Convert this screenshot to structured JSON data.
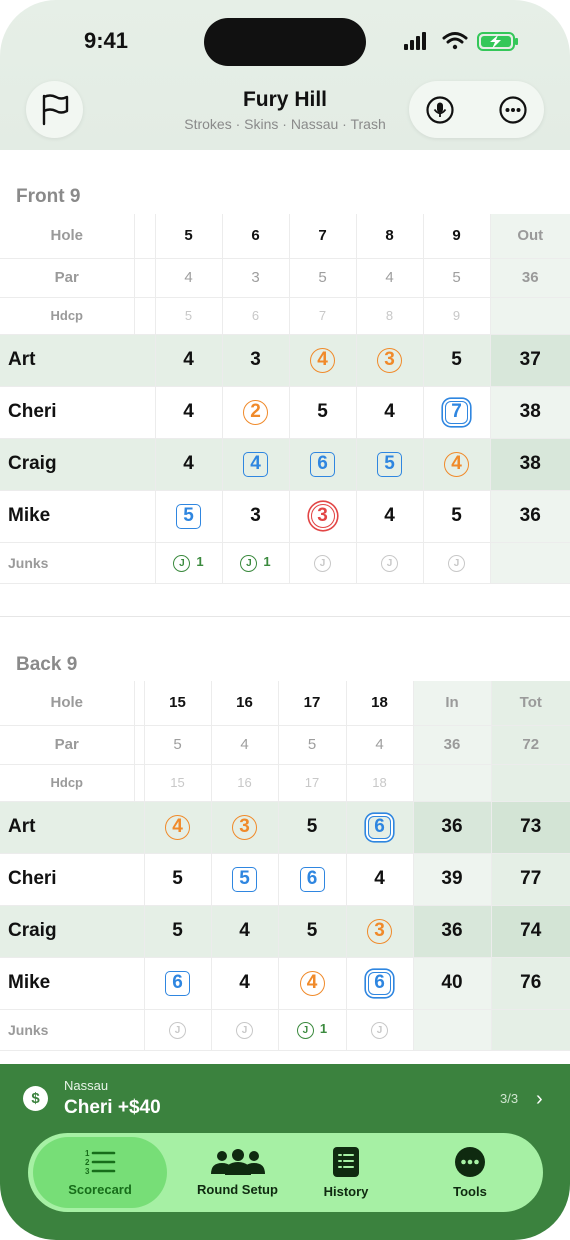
{
  "status": {
    "time": "9:41"
  },
  "header": {
    "title": "Fury Hill",
    "subtitle": "Strokes · Skins · Nassau · Trash",
    "flag_icon": "flag-icon",
    "mic_icon": "microphone-icon",
    "more_icon": "ellipsis-icon"
  },
  "front": {
    "title": "Front 9",
    "labels": {
      "hole": "Hole",
      "par": "Par",
      "hdcp": "Hdcp",
      "junks": "Junks"
    },
    "holes": [
      "5",
      "6",
      "7",
      "8",
      "9"
    ],
    "total_label": "Out",
    "par": [
      "4",
      "3",
      "5",
      "4",
      "5"
    ],
    "par_total": "36",
    "hdcp": [
      "5",
      "6",
      "7",
      "8",
      "9"
    ],
    "players": [
      {
        "name": "Art",
        "scores": [
          "4",
          "3",
          "4",
          "3",
          "5"
        ],
        "total": "37"
      },
      {
        "name": "Cheri",
        "scores": [
          "4",
          "2",
          "5",
          "4",
          "7"
        ],
        "total": "38"
      },
      {
        "name": "Craig",
        "scores": [
          "4",
          "4",
          "6",
          "5",
          "4"
        ],
        "total": "38"
      },
      {
        "name": "Mike",
        "scores": [
          "5",
          "3",
          "3",
          "4",
          "5"
        ],
        "total": "36"
      }
    ],
    "junk_counts": [
      "1",
      "1",
      "",
      "",
      ""
    ]
  },
  "back": {
    "title": "Back 9",
    "labels": {
      "hole": "Hole",
      "par": "Par",
      "hdcp": "Hdcp",
      "junks": "Junks"
    },
    "holes": [
      "15",
      "16",
      "17",
      "18"
    ],
    "in_label": "In",
    "tot_label": "Tot",
    "par": [
      "5",
      "4",
      "5",
      "4"
    ],
    "par_in": "36",
    "par_tot": "72",
    "hdcp": [
      "15",
      "16",
      "17",
      "18"
    ],
    "players": [
      {
        "name": "Art",
        "scores": [
          "4",
          "3",
          "5",
          "6"
        ],
        "in": "36",
        "tot": "73"
      },
      {
        "name": "Cheri",
        "scores": [
          "5",
          "5",
          "6",
          "4"
        ],
        "in": "39",
        "tot": "77"
      },
      {
        "name": "Craig",
        "scores": [
          "5",
          "4",
          "5",
          "3"
        ],
        "in": "36",
        "tot": "74"
      },
      {
        "name": "Mike",
        "scores": [
          "6",
          "4",
          "4",
          "6"
        ],
        "in": "40",
        "tot": "76"
      }
    ],
    "junk_counts": [
      "",
      "",
      "1",
      ""
    ]
  },
  "junk_glyph": "J",
  "banner": {
    "title": "Nassau",
    "value": "Cheri +$40",
    "page": "3/3",
    "dollar": "$",
    "chevron": "›"
  },
  "tabs": [
    {
      "label": "Scorecard",
      "icon": "list-numbered-icon"
    },
    {
      "label": "Round Setup",
      "icon": "people-icon"
    },
    {
      "label": "History",
      "icon": "notebook-icon"
    },
    {
      "label": "Tools",
      "icon": "ellipsis-circle-icon"
    }
  ],
  "colors": {
    "accent_green": "#3b823e",
    "birdie_orange": "#f08a2a",
    "bogey_blue": "#2f86e0",
    "eagle_red": "#e24545"
  }
}
